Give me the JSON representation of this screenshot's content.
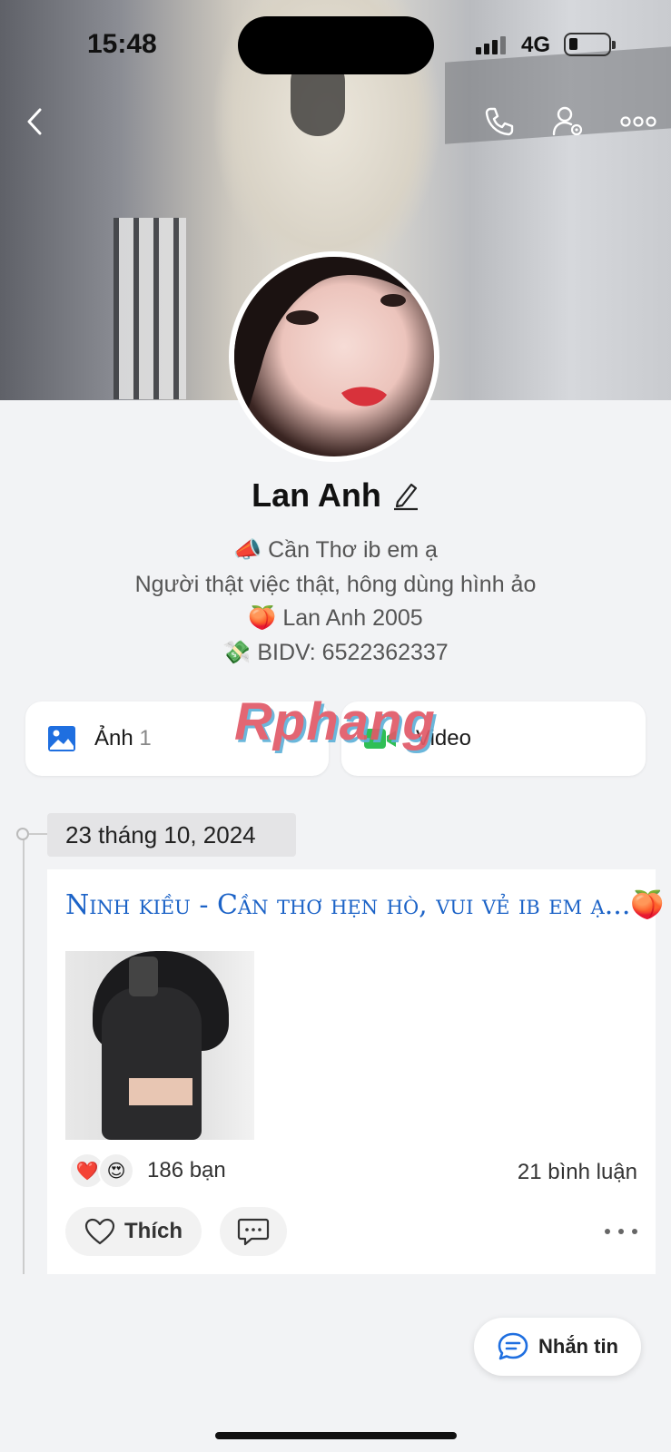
{
  "status_bar": {
    "time": "15:48",
    "network": "4G"
  },
  "profile": {
    "name": "Lan Anh",
    "bio": [
      "📣 Cần Thơ ib em ạ",
      "Người thật việc thật, hông dùng hình ảo",
      "🍑 Lan Anh 2005",
      "💸 BIDV: 6522362337"
    ]
  },
  "media_tabs": {
    "photos": {
      "label": "Ảnh",
      "count": "1"
    },
    "videos": {
      "label": "Video"
    }
  },
  "watermark": "Rphang",
  "timeline": {
    "date": "23 tháng 10, 2024",
    "post": {
      "text": "Ninh kiều - Cần thơ hẹn hò, vui vẻ ib em ạ...🍑",
      "reactions": [
        "❤️",
        "😍"
      ],
      "reaction_count": "186 bạn",
      "comment_count": "21 bình luận",
      "like_label": "Thích"
    }
  },
  "message_button": {
    "label": "Nhắn tin"
  },
  "colors": {
    "accent": "#1c63c7",
    "background": "#f2f3f5",
    "video_icon": "#2fbf55",
    "photo_icon": "#1f6fe0"
  },
  "icons": [
    "back-icon",
    "phone-icon",
    "user-settings-icon",
    "more-icon",
    "edit-icon",
    "photo-icon",
    "video-icon",
    "heart-icon",
    "comment-icon",
    "chat-icon"
  ]
}
